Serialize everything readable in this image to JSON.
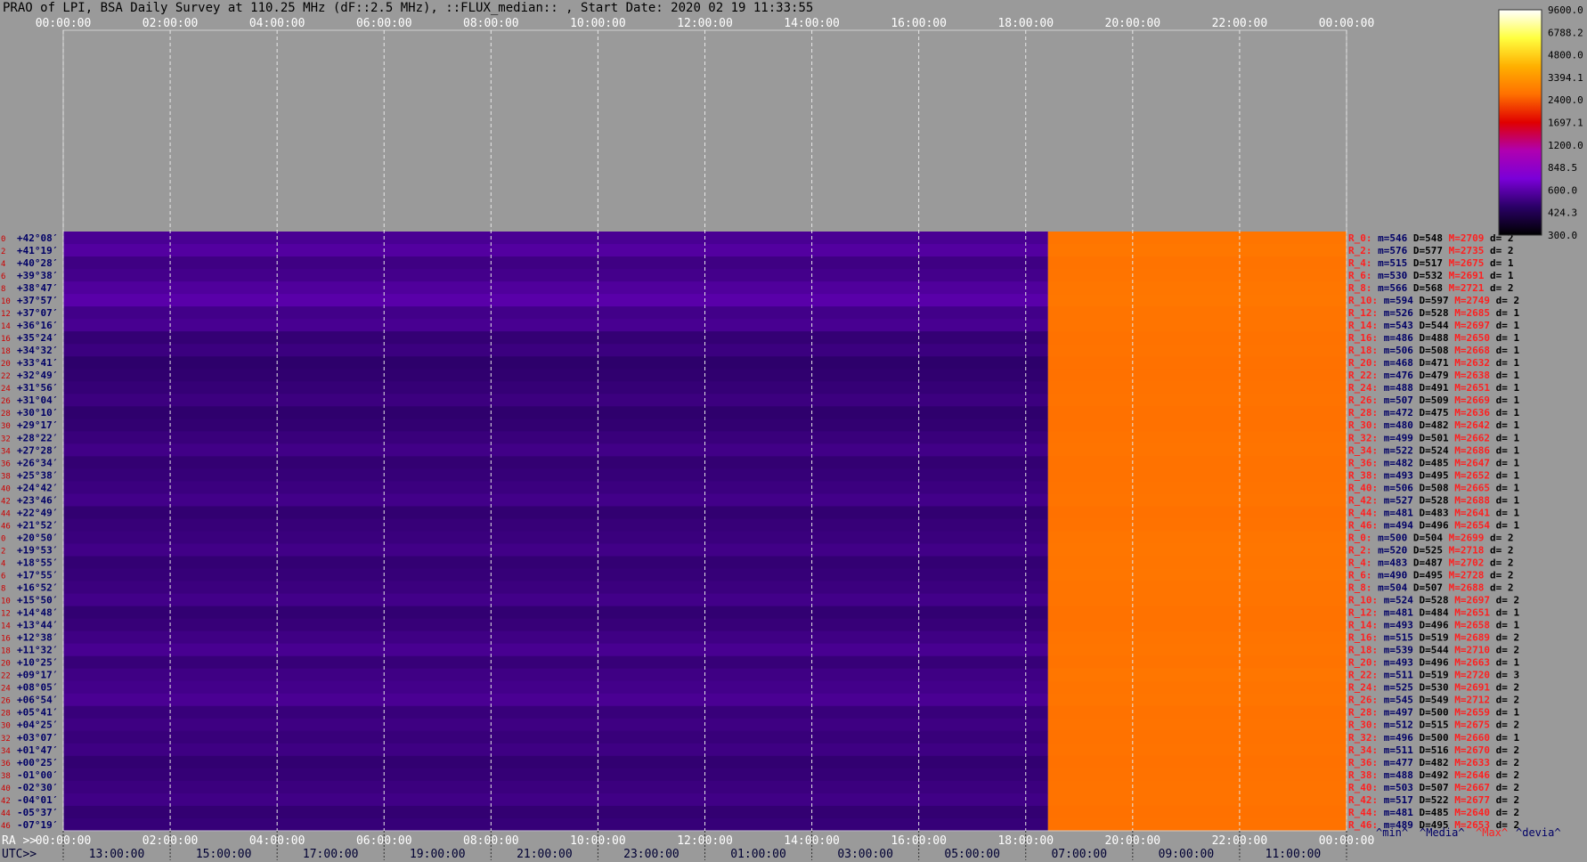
{
  "title": "PRAO of LPI, BSA Daily Survey at 110.25 MHz (dF::2.5 MHz), ::FLUX_median:: , Start Date: 2020 02 19 11:33:55",
  "chart_data": {
    "type": "heatmap",
    "x_top_ticks": [
      "00:00:00",
      "02:00:00",
      "04:00:00",
      "06:00:00",
      "08:00:00",
      "10:00:00",
      "12:00:00",
      "14:00:00",
      "16:00:00",
      "18:00:00",
      "20:00:00",
      "22:00:00",
      "00:00:00"
    ],
    "ra_label": "RA >>",
    "ra_ticks": [
      "00:00:00",
      "02:00:00",
      "04:00:00",
      "06:00:00",
      "08:00:00",
      "10:00:00",
      "12:00:00",
      "14:00:00",
      "16:00:00",
      "18:00:00",
      "20:00:00",
      "22:00:00",
      "00:00:00"
    ],
    "utc_label": "UTC>>",
    "utc_ticks": [
      "13:00:00",
      "15:00:00",
      "17:00:00",
      "19:00:00",
      "21:00:00",
      "23:00:00",
      "01:00:00",
      "03:00:00",
      "05:00:00",
      "07:00:00",
      "09:00:00",
      "11:00:00"
    ],
    "colorbar": {
      "ticks": [
        "9600.0",
        "6788.2",
        "4800.0",
        "3394.1",
        "2400.0",
        "1697.1",
        "1200.0",
        "848.5",
        "600.0",
        "424.3",
        "300.0"
      ],
      "range": [
        300,
        9600
      ],
      "scale": "log",
      "colors": [
        "#000000",
        "#2a0066",
        "#7a00d8",
        "#b000b0",
        "#e00000",
        "#ff7000",
        "#ffb000",
        "#ffff40",
        "#ffffff"
      ]
    },
    "ra_boundary": "18:25:00",
    "left_value_range": [
      460,
      600
    ],
    "right_value_range": [
      2630,
      2760
    ],
    "declinations": [
      "+42°08′",
      "+41°19′",
      "+40°28′",
      "+39°38′",
      "+38°47′",
      "+37°57′",
      "+37°07′",
      "+36°16′",
      "+35°24′",
      "+34°32′",
      "+33°41′",
      "+32°49′",
      "+31°56′",
      "+31°04′",
      "+30°10′",
      "+29°17′",
      "+28°22′",
      "+27°28′",
      "+26°34′",
      "+25°38′",
      "+24°42′",
      "+23°46′",
      "+22°49′",
      "+21°52′",
      "+20°50′",
      "+19°53′",
      "+18°55′",
      "+17°55′",
      "+16°52′",
      "+15°50′",
      "+14°48′",
      "+13°44′",
      "+12°38′",
      "+11°32′",
      "+10°25′",
      "+09°17′",
      "+08°05′",
      "+06°54′",
      "+05°41′",
      "+04°25′",
      "+03°07′",
      "+01°47′",
      "+00°25′",
      "-01°00′",
      "-02°30′",
      "-04°01′",
      "-05°37′",
      "-07°19′"
    ],
    "stats": [
      {
        "r": "R_0:",
        "m": 546,
        "D": 548,
        "M": 2709,
        "d": 2
      },
      {
        "r": "R_2:",
        "m": 576,
        "D": 577,
        "M": 2735,
        "d": 2
      },
      {
        "r": "R_4:",
        "m": 515,
        "D": 517,
        "M": 2675,
        "d": 1
      },
      {
        "r": "R_6:",
        "m": 530,
        "D": 532,
        "M": 2691,
        "d": 1
      },
      {
        "r": "R_8:",
        "m": 566,
        "D": 568,
        "M": 2721,
        "d": 2
      },
      {
        "r": "R_10:",
        "m": 594,
        "D": 597,
        "M": 2749,
        "d": 2
      },
      {
        "r": "R_12:",
        "m": 526,
        "D": 528,
        "M": 2685,
        "d": 1
      },
      {
        "r": "R_14:",
        "m": 543,
        "D": 544,
        "M": 2697,
        "d": 1
      },
      {
        "r": "R_16:",
        "m": 486,
        "D": 488,
        "M": 2650,
        "d": 1
      },
      {
        "r": "R_18:",
        "m": 506,
        "D": 508,
        "M": 2668,
        "d": 1
      },
      {
        "r": "R_20:",
        "m": 468,
        "D": 471,
        "M": 2632,
        "d": 1
      },
      {
        "r": "R_22:",
        "m": 476,
        "D": 479,
        "M": 2638,
        "d": 1
      },
      {
        "r": "R_24:",
        "m": 488,
        "D": 491,
        "M": 2651,
        "d": 1
      },
      {
        "r": "R_26:",
        "m": 507,
        "D": 509,
        "M": 2669,
        "d": 1
      },
      {
        "r": "R_28:",
        "m": 472,
        "D": 475,
        "M": 2636,
        "d": 1
      },
      {
        "r": "R_30:",
        "m": 480,
        "D": 482,
        "M": 2642,
        "d": 1
      },
      {
        "r": "R_32:",
        "m": 499,
        "D": 501,
        "M": 2662,
        "d": 1
      },
      {
        "r": "R_34:",
        "m": 522,
        "D": 524,
        "M": 2686,
        "d": 1
      },
      {
        "r": "R_36:",
        "m": 482,
        "D": 485,
        "M": 2647,
        "d": 1
      },
      {
        "r": "R_38:",
        "m": 493,
        "D": 495,
        "M": 2652,
        "d": 1
      },
      {
        "r": "R_40:",
        "m": 506,
        "D": 508,
        "M": 2665,
        "d": 1
      },
      {
        "r": "R_42:",
        "m": 527,
        "D": 528,
        "M": 2688,
        "d": 1
      },
      {
        "r": "R_44:",
        "m": 481,
        "D": 483,
        "M": 2641,
        "d": 1
      },
      {
        "r": "R_46:",
        "m": 494,
        "D": 496,
        "M": 2654,
        "d": 1
      },
      {
        "r": "R_0:",
        "m": 500,
        "D": 504,
        "M": 2699,
        "d": 2
      },
      {
        "r": "R_2:",
        "m": 520,
        "D": 525,
        "M": 2718,
        "d": 2
      },
      {
        "r": "R_4:",
        "m": 483,
        "D": 487,
        "M": 2702,
        "d": 2
      },
      {
        "r": "R_6:",
        "m": 490,
        "D": 495,
        "M": 2728,
        "d": 2
      },
      {
        "r": "R_8:",
        "m": 504,
        "D": 507,
        "M": 2688,
        "d": 2
      },
      {
        "r": "R_10:",
        "m": 524,
        "D": 528,
        "M": 2697,
        "d": 2
      },
      {
        "r": "R_12:",
        "m": 481,
        "D": 484,
        "M": 2651,
        "d": 1
      },
      {
        "r": "R_14:",
        "m": 493,
        "D": 496,
        "M": 2658,
        "d": 1
      },
      {
        "r": "R_16:",
        "m": 515,
        "D": 519,
        "M": 2689,
        "d": 2
      },
      {
        "r": "R_18:",
        "m": 539,
        "D": 544,
        "M": 2710,
        "d": 2
      },
      {
        "r": "R_20:",
        "m": 493,
        "D": 496,
        "M": 2663,
        "d": 1
      },
      {
        "r": "R_22:",
        "m": 511,
        "D": 519,
        "M": 2720,
        "d": 3
      },
      {
        "r": "R_24:",
        "m": 525,
        "D": 530,
        "M": 2691,
        "d": 2
      },
      {
        "r": "R_26:",
        "m": 545,
        "D": 549,
        "M": 2712,
        "d": 2
      },
      {
        "r": "R_28:",
        "m": 497,
        "D": 500,
        "M": 2659,
        "d": 1
      },
      {
        "r": "R_30:",
        "m": 512,
        "D": 515,
        "M": 2675,
        "d": 2
      },
      {
        "r": "R_32:",
        "m": 496,
        "D": 500,
        "M": 2660,
        "d": 1
      },
      {
        "r": "R_34:",
        "m": 511,
        "D": 516,
        "M": 2670,
        "d": 2
      },
      {
        "r": "R_36:",
        "m": 477,
        "D": 482,
        "M": 2633,
        "d": 2
      },
      {
        "r": "R_38:",
        "m": 488,
        "D": 492,
        "M": 2646,
        "d": 2
      },
      {
        "r": "R_40:",
        "m": 503,
        "D": 507,
        "M": 2667,
        "d": 2
      },
      {
        "r": "R_42:",
        "m": 517,
        "D": 522,
        "M": 2677,
        "d": 2
      },
      {
        "r": "R_44:",
        "m": 481,
        "D": 485,
        "M": 2640,
        "d": 2
      },
      {
        "r": "R_46:",
        "m": 489,
        "D": 495,
        "M": 2653,
        "d": 2
      }
    ],
    "stats_legend": {
      "min": "^min^",
      "median": "^Media^",
      "max": "^Max^",
      "dev": "^devia^"
    }
  }
}
